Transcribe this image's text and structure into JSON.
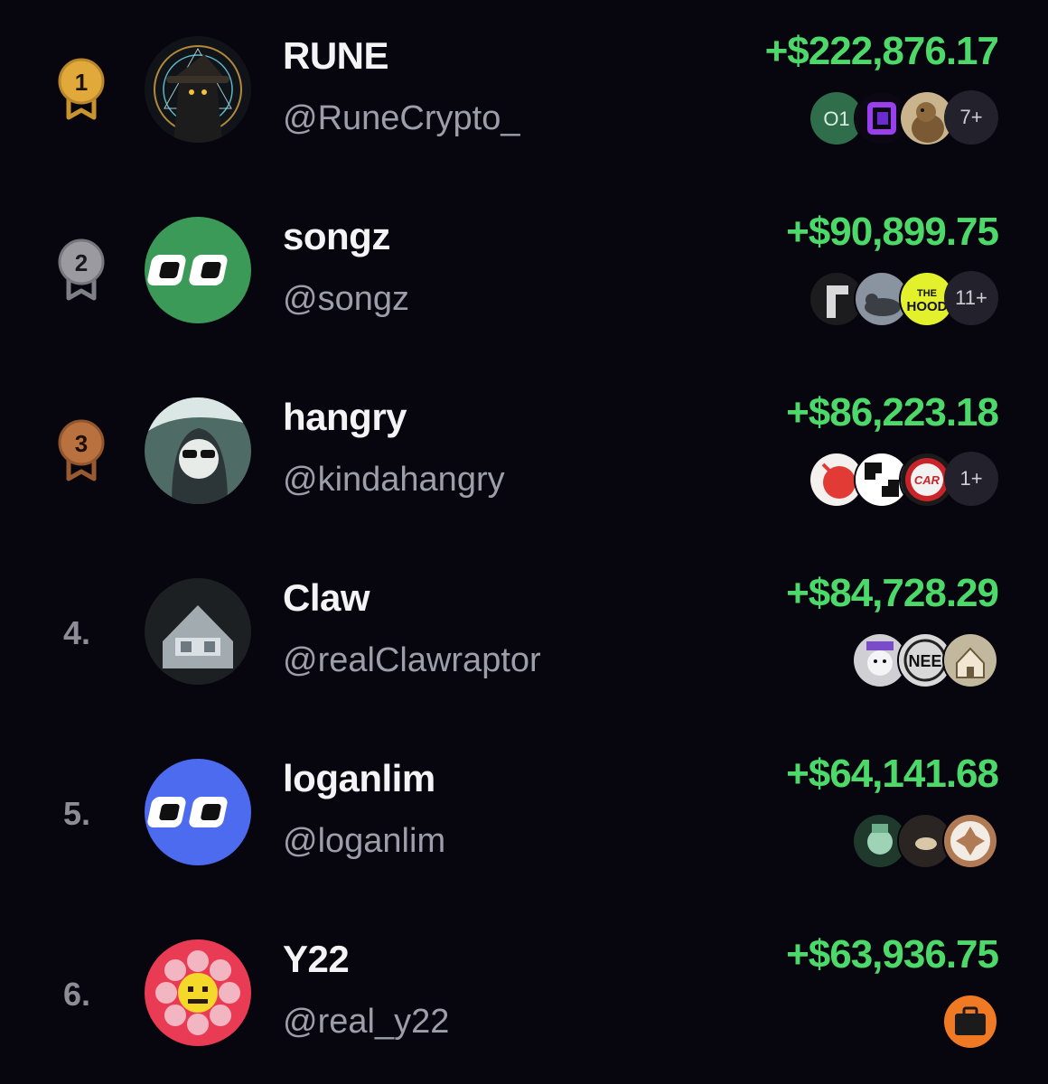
{
  "leaderboard": {
    "rows": [
      {
        "rank": "1",
        "name": "RUNE",
        "handle": "@RuneCrypto_",
        "pnl": "+$222,876.17",
        "more": "7+"
      },
      {
        "rank": "2",
        "name": "songz",
        "handle": "@songz",
        "pnl": "+$90,899.75",
        "more": "11+"
      },
      {
        "rank": "3",
        "name": "hangry",
        "handle": "@kindahangry",
        "pnl": "+$86,223.18",
        "more": "1+"
      },
      {
        "rank": "4.",
        "name": "Claw",
        "handle": "@realClawraptor",
        "pnl": "+$84,728.29"
      },
      {
        "rank": "5.",
        "name": "loganlim",
        "handle": "@loganlim",
        "pnl": "+$64,141.68"
      },
      {
        "rank": "6.",
        "name": "Y22",
        "handle": "@real_y22",
        "pnl": "+$63,936.75"
      }
    ],
    "colors": {
      "background": "#07060e",
      "positive": "#4cd96a",
      "gold": "#e0a93a",
      "silver": "#9a9aa0",
      "bronze": "#b9713f"
    },
    "icons": [
      "medal-gold-icon",
      "medal-silver-icon",
      "medal-bronze-icon"
    ]
  }
}
